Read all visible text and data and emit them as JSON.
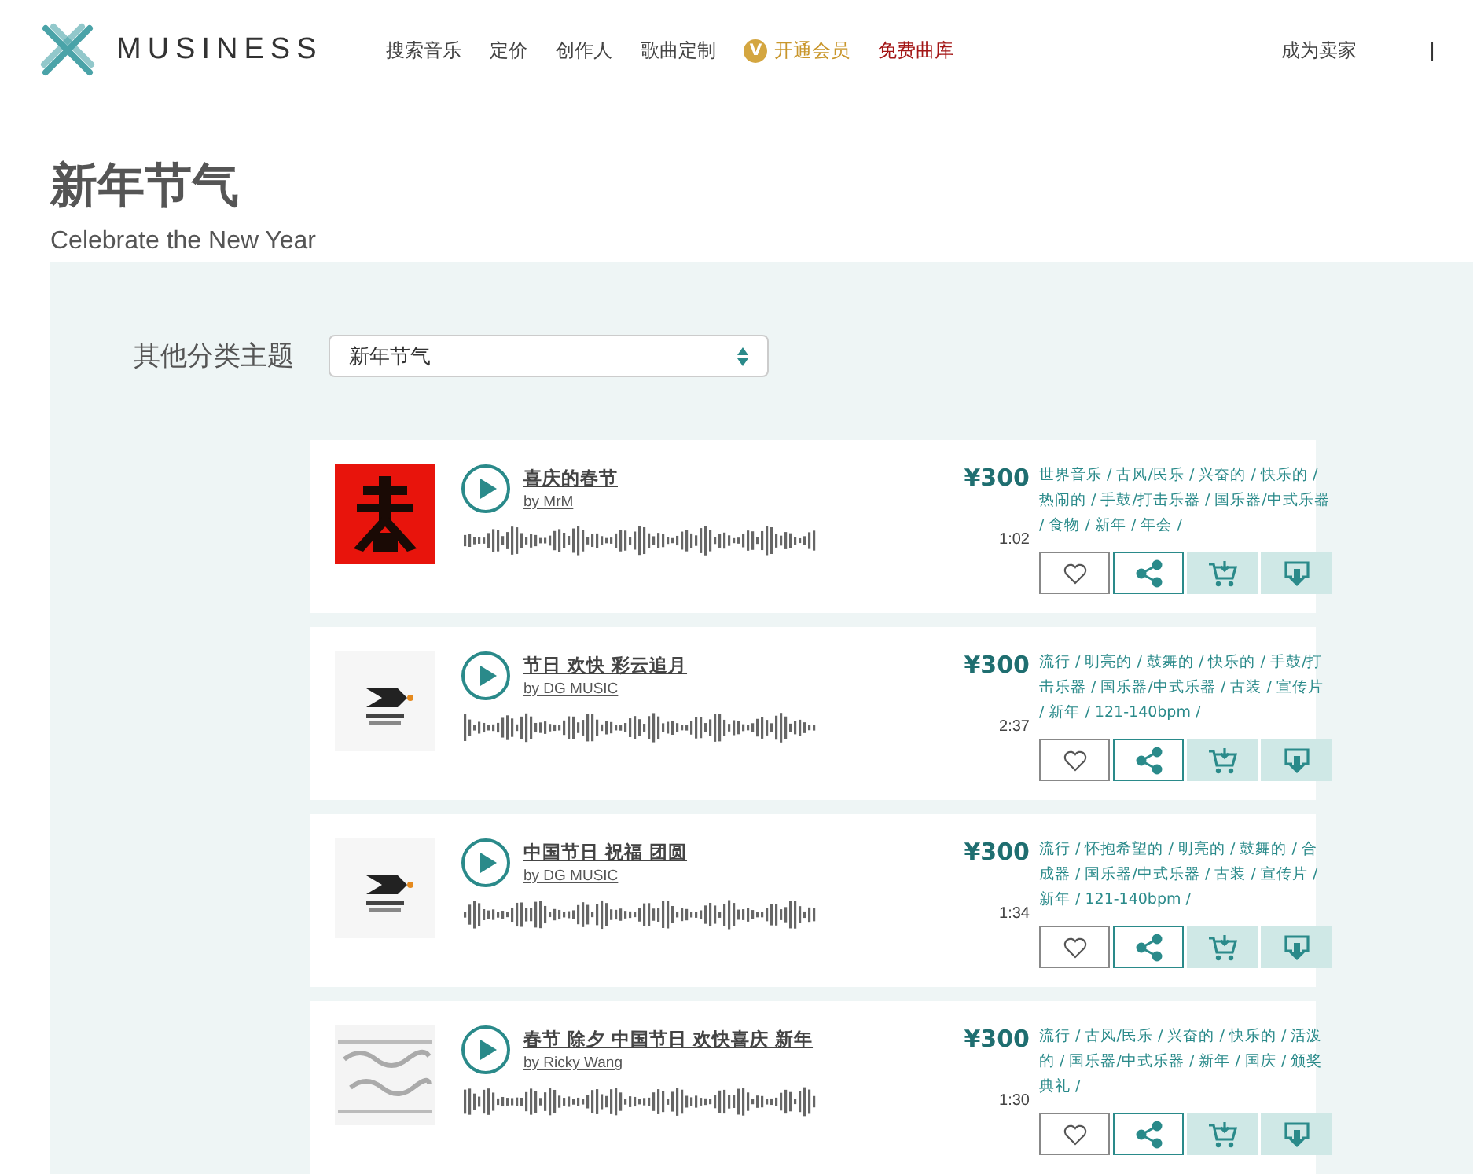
{
  "header": {
    "brand": "MUSINESS",
    "nav": [
      {
        "label": "搜索音乐",
        "kind": "plain"
      },
      {
        "label": "定价",
        "kind": "plain"
      },
      {
        "label": "创作人",
        "kind": "plain"
      },
      {
        "label": "歌曲定制",
        "kind": "plain"
      },
      {
        "label": "开通会员",
        "kind": "vip",
        "badge": "V"
      },
      {
        "label": "免费曲库",
        "kind": "free"
      }
    ],
    "seller": "成为卖家",
    "divider": "|"
  },
  "page": {
    "title": "新年节气",
    "subtitle": "Celebrate the New Year"
  },
  "filter": {
    "label": "其他分类主题",
    "value": "新年节气"
  },
  "tracks": [
    {
      "title": "喜庆的春节",
      "artist": "by MrM",
      "price": "¥300",
      "duration": "1:02",
      "tags": "世界音乐 / 古风/民乐 / 兴奋的 / 快乐的 / 热闹的 / 手鼓/打击乐器 / 国乐器/中式乐器 / 食物 / 新年 / 年会 /"
    },
    {
      "title": "节日 欢快 彩云追月",
      "artist": "by DG MUSIC",
      "price": "¥300",
      "duration": "2:37",
      "tags": "流行 / 明亮的 / 鼓舞的 / 快乐的 / 手鼓/打击乐器 / 国乐器/中式乐器 / 古装 / 宣传片 / 新年 / 121-140bpm /"
    },
    {
      "title": "中国节日 祝福 团圆",
      "artist": "by DG MUSIC",
      "price": "¥300",
      "duration": "1:34",
      "tags": "流行 / 怀抱希望的 / 明亮的 / 鼓舞的 / 合成器 / 国乐器/中式乐器 / 古装 / 宣传片 / 新年 / 121-140bpm /"
    },
    {
      "title": "春节 除夕 中国节日 欢快喜庆 新年",
      "artist": "by Ricky Wang",
      "price": "¥300",
      "duration": "1:30",
      "tags": "流行 / 古风/民乐 / 兴奋的 / 快乐的 / 活泼的 / 国乐器/中式乐器 / 新年 / 国庆 / 颁奖典礼 /"
    }
  ]
}
